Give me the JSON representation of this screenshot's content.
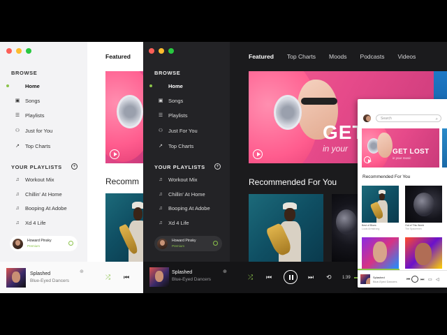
{
  "light_window": {
    "browse_label": "BROWSE",
    "nav": [
      {
        "label": "Home",
        "icon": "home-icon"
      },
      {
        "label": "Songs",
        "icon": "songs-icon"
      },
      {
        "label": "Playlists",
        "icon": "playlist-icon"
      },
      {
        "label": "Just for You",
        "icon": "people-icon"
      },
      {
        "label": "Top Charts",
        "icon": "chart-icon"
      }
    ],
    "playlists_label": "YOUR PLAYLISTS",
    "playlists": [
      "Workout Mix",
      "Chillin' At Home",
      "Booping At Adobe",
      "Xd 4 Life"
    ],
    "user": {
      "name": "Howard Pinsky",
      "status": "Premium"
    },
    "featured": "Featured",
    "recommended": "Recomm",
    "player": {
      "track": "Splashed",
      "artist": "Blue-Eyed Dancers"
    }
  },
  "dark_window": {
    "browse_label": "BROWSE",
    "nav": [
      {
        "label": "Home",
        "icon": "home-icon"
      },
      {
        "label": "Songs",
        "icon": "songs-icon"
      },
      {
        "label": "Playlists",
        "icon": "playlist-icon"
      },
      {
        "label": "Just For You",
        "icon": "people-icon"
      },
      {
        "label": "Top Charts",
        "icon": "chart-icon"
      }
    ],
    "playlists_label": "YOUR PLAYLISTS",
    "playlists": [
      "Workout Mix",
      "Chillin' At Home",
      "Booping At Adobe",
      "Xd 4 Life"
    ],
    "user": {
      "name": "Howard Pinsky",
      "status": "Premium"
    },
    "tabs": [
      "Featured",
      "Top Charts",
      "Moods",
      "Podcasts",
      "Videos"
    ],
    "hero": {
      "headline": "GET",
      "subline": "in your"
    },
    "recommended": "Recommended For You",
    "player": {
      "track": "Splashed",
      "artist": "Blue-Eyed Dancers",
      "time": "1:39"
    }
  },
  "small_window": {
    "search_placeholder": "Search",
    "hero": {
      "headline": "GET LOST",
      "subline": "in your music"
    },
    "recommended": "Recommended For You",
    "cards": [
      {
        "title": "Best of Blues",
        "subtitle": "Louis Armstrong"
      },
      {
        "title": "Out of This World",
        "subtitle": "The Spacemen"
      }
    ],
    "player": {
      "track": "Splashed",
      "artist": "Blue-Eyed Dancers"
    }
  },
  "colors": {
    "accent": "#8bc34a",
    "hero_pink": "#e64a8a"
  }
}
